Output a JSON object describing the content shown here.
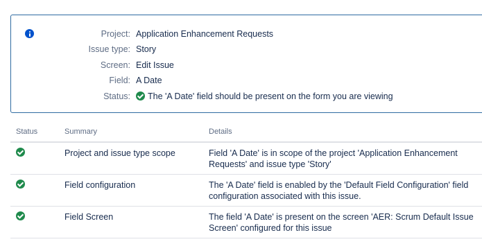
{
  "panel": {
    "icon": "info-icon",
    "rows": [
      {
        "label": "Project:",
        "value": "Application Enhancement Requests"
      },
      {
        "label": "Issue type:",
        "value": "Story"
      },
      {
        "label": "Screen:",
        "value": "Edit Issue"
      },
      {
        "label": "Field:",
        "value": "A Date"
      },
      {
        "label": "Status:",
        "value": "The 'A Date' field should be present on the form you are viewing",
        "icon": "check-circle-icon"
      }
    ]
  },
  "table": {
    "headers": [
      "Status",
      "Summary",
      "Details"
    ],
    "rows": [
      {
        "status_icon": "check-circle-icon",
        "summary": "Project and issue type scope",
        "details": "Field 'A Date' is in scope of the project 'Application Enhancement Requests' and issue type 'Story'"
      },
      {
        "status_icon": "check-circle-icon",
        "summary": "Field configuration",
        "details": "The 'A Date' field is enabled by the 'Default Field Configuration' field configuration associated with this issue."
      },
      {
        "status_icon": "check-circle-icon",
        "summary": "Field Screen",
        "details": "The field 'A Date' is present on the screen 'AER: Scrum Default Issue Screen' configured for this issue"
      }
    ]
  },
  "colors": {
    "panel_border": "#2e6aa1",
    "info_icon": "#0052cc",
    "success": "#1f8a4c",
    "label_text": "#5e6c84",
    "body_text": "#172b4d"
  }
}
